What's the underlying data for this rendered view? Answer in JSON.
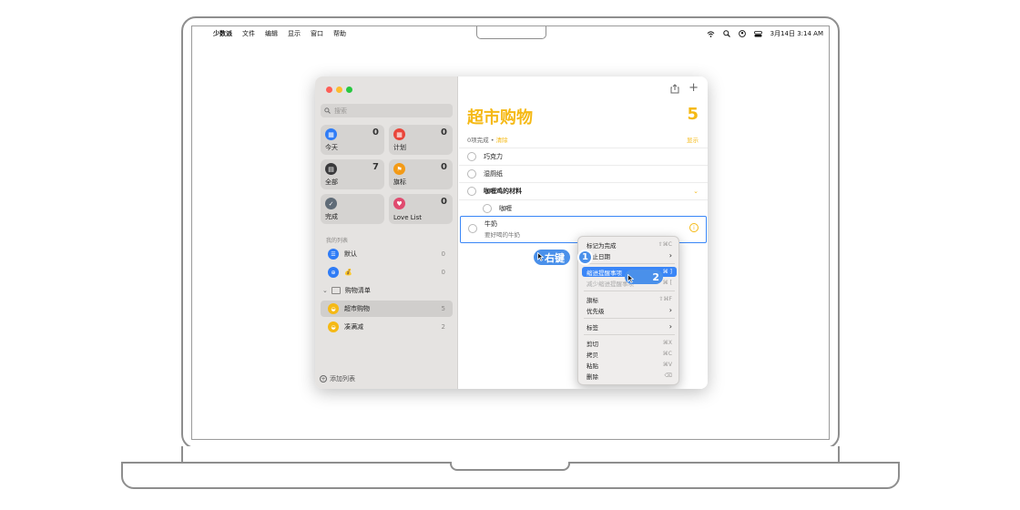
{
  "menubar": {
    "app": "少数派",
    "items": [
      "文件",
      "编辑",
      "显示",
      "窗口",
      "帮助"
    ],
    "datetime": "3月14日  3:14 AM"
  },
  "sidebar": {
    "search_placeholder": "搜索",
    "tiles": [
      {
        "label": "今天",
        "count": "0",
        "color": "#2f7cf6"
      },
      {
        "label": "计划",
        "count": "0",
        "color": "#e9453a"
      },
      {
        "label": "全部",
        "count": "7",
        "color": "#3a3a3c"
      },
      {
        "label": "旗标",
        "count": "0",
        "color": "#f39a16"
      },
      {
        "label": "完成",
        "count": "",
        "color": "#5f6b77"
      },
      {
        "label": "Love List",
        "count": "0",
        "color": "#e04b6f"
      }
    ],
    "my_lists_title": "我的列表",
    "lists": [
      {
        "label": "默认",
        "count": "0"
      },
      {
        "label": "💰",
        "count": "0"
      }
    ],
    "group": {
      "label": "购物清单"
    },
    "group_lists": [
      {
        "label": "超市购物",
        "count": "5"
      },
      {
        "label": "凑满减",
        "count": "2"
      }
    ],
    "add_list": "添加列表"
  },
  "main": {
    "title": "超市购物",
    "count": "5",
    "completed": "0项完成",
    "clear": "清除",
    "show": "显示",
    "items": [
      {
        "label": "巧克力"
      },
      {
        "label": "湿厕纸"
      },
      {
        "label": "咖喱鸡的材料"
      },
      {
        "label": "咖喱"
      }
    ],
    "selected": {
      "label": "牛奶",
      "note": "要好喝的牛奶"
    }
  },
  "context_menu": {
    "items": [
      {
        "label": "标记为完成",
        "shortcut": "⇧⌘C"
      },
      {
        "label": "截止日期",
        "shortcut": "›"
      },
      {
        "label": "缩进提醒事项",
        "shortcut": "⌘ ]"
      },
      {
        "label": "减少缩进提醒事项",
        "shortcut": "⌘ ["
      },
      {
        "label": "旗标",
        "shortcut": "⇧⌘F"
      },
      {
        "label": "优先级",
        "shortcut": "›"
      },
      {
        "label": "标签",
        "shortcut": "›"
      },
      {
        "label": "剪切",
        "shortcut": "⌘X"
      },
      {
        "label": "拷贝",
        "shortcut": "⌘C"
      },
      {
        "label": "粘贴",
        "shortcut": "⌘V"
      },
      {
        "label": "删除",
        "shortcut": "⌫"
      }
    ]
  },
  "callouts": {
    "right_click": "右键",
    "step1": "1",
    "step2": "2"
  }
}
